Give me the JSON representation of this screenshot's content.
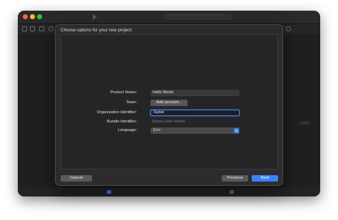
{
  "sheet": {
    "title": "Choose options for your new project:"
  },
  "form": {
    "product_name_label": "Product Name:",
    "product_name_value": "Hello World",
    "team_label": "Team:",
    "add_account_label": "Add account...",
    "org_identifier_label": "Organization Identifier:",
    "org_identifier_value": "Siytek",
    "bundle_identifier_label": "Bundle Identifier:",
    "bundle_identifier_value": "Siytek.Hello-World",
    "language_label": "Language:",
    "language_value": "C++"
  },
  "buttons": {
    "cancel": "Cancel",
    "previous": "Previous",
    "next": "Next"
  },
  "background": {
    "partial_text": "ction"
  },
  "colors": {
    "accent": "#3a82f7",
    "sheet_bg": "#2c2c2e",
    "window_bg": "#1f1f21"
  }
}
